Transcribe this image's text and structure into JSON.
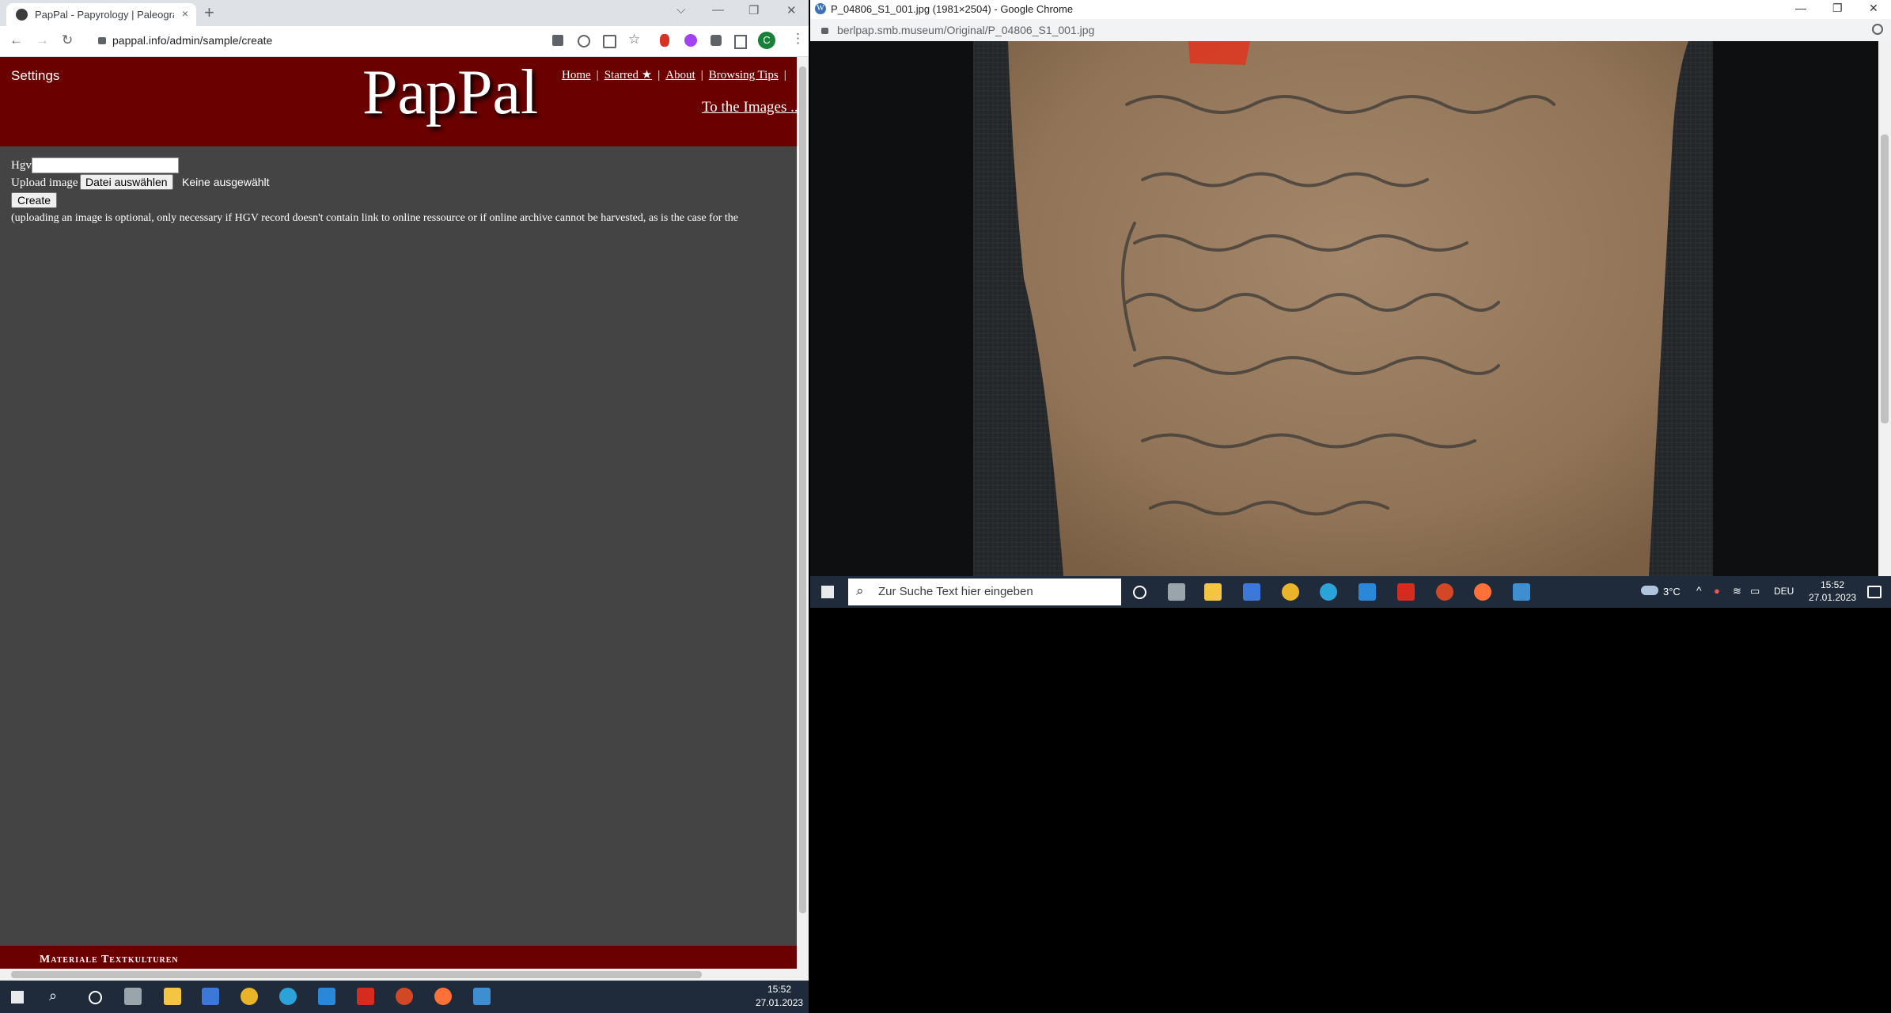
{
  "left_window": {
    "tab_title": "PapPal - Papyrology | Paleograph",
    "tab_close": "×",
    "new_tab": "+",
    "url": "pappal.info/admin/sample/create",
    "window_min": "—",
    "window_restore": "❐",
    "window_close": "✕",
    "nav_back": "←",
    "nav_forward": "→",
    "nav_reload": "↻",
    "tab_search": "⌵",
    "avatar_letter": "C",
    "page": {
      "settings_label": "Settings",
      "logo": "PapPal",
      "nav": [
        {
          "label": "Home"
        },
        {
          "label": "Starred ★"
        },
        {
          "label": "About"
        },
        {
          "label": "Browsing Tips"
        }
      ],
      "to_images": "To the Images ...",
      "hgv_label": "Hgv",
      "hgv_value": "",
      "upload_label": "Upload image",
      "file_button": "Datei auswählen",
      "no_file": "Keine ausgewählt",
      "create_button": "Create",
      "note": "(uploading an image is optional, only necessary if HGV record doesn't contain link to online ressource or if online archive cannot be harvested, as is the case for the",
      "footer_text": "Materiale Textkulturen"
    }
  },
  "right_window": {
    "title": "P_04806_S1_001.jpg (1981×2504) - Google Chrome",
    "url": "berlpap.smb.museum/Original/P_04806_S1_001.jpg",
    "window_min": "—",
    "window_restore": "❐",
    "window_close": "✕"
  },
  "taskbar_right": {
    "search_placeholder": "Zur Suche Text hier eingeben",
    "weather": "3°C",
    "language": "DEU",
    "time": "15:52",
    "date": "27.01.2023"
  },
  "taskbar_left": {
    "time": "15:52",
    "date": "27.01.2023"
  }
}
